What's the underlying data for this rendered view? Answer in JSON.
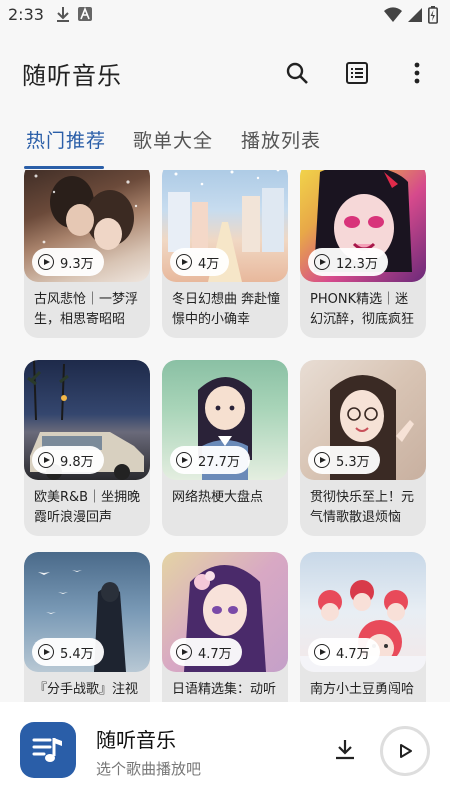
{
  "status": {
    "time": "2:33"
  },
  "app": {
    "title": "随听音乐"
  },
  "tabs": [
    {
      "label": "热门推荐",
      "active": true
    },
    {
      "label": "歌单大全",
      "active": false
    },
    {
      "label": "播放列表",
      "active": false
    }
  ],
  "cards": [
    {
      "plays": "9.3万",
      "title": "古风悲怆｜一梦浮生，相思寄昭昭"
    },
    {
      "plays": "4万",
      "title": "冬日幻想曲 奔赴憧憬中的小确幸"
    },
    {
      "plays": "12.3万",
      "title": "PHONK精选｜迷幻沉醉，彻底疯狂"
    },
    {
      "plays": "9.8万",
      "title": "欧美R&B｜坐拥晚霞听浪漫回声"
    },
    {
      "plays": "27.7万",
      "title": "网络热梗大盘点"
    },
    {
      "plays": "5.3万",
      "title": "贯彻快乐至上！元气情歌散退烦恼"
    },
    {
      "plays": "5.4万",
      "title": "『分手战歌』注视"
    },
    {
      "plays": "4.7万",
      "title": "日语精选集：动听"
    },
    {
      "plays": "4.7万",
      "title": "南方小土豆勇闯哈"
    }
  ],
  "player": {
    "title": "随听音乐",
    "subtitle": "选个歌曲播放吧"
  },
  "colors": {
    "accent": "#2a5ea8",
    "background": "#f7f7f7"
  },
  "icons": [
    "download-icon",
    "text-a-icon",
    "wifi-icon",
    "signal-icon",
    "battery-icon",
    "search-icon",
    "list-icon",
    "more-vert-icon",
    "music-note-icon",
    "play-icon"
  ]
}
